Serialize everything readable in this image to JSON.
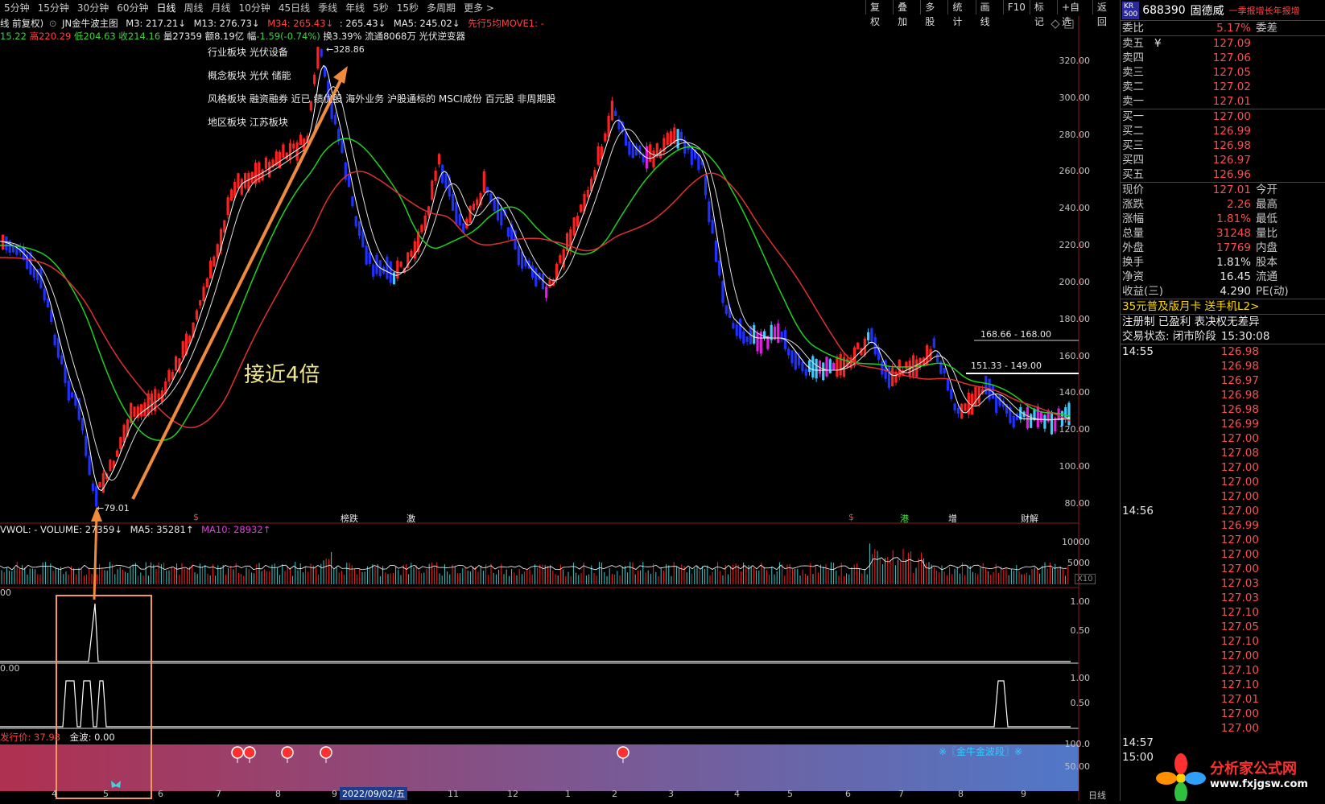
{
  "top_tabs": [
    "5分钟",
    "15分钟",
    "30分钟",
    "60分钟",
    "日线",
    "周线",
    "月线",
    "10分钟",
    "45日线",
    "季线",
    "年线",
    "5秒",
    "15秒",
    "多周期",
    "更多 >"
  ],
  "active_tab": "日线",
  "toolbar": [
    "复权",
    "叠加",
    "多股",
    "统计",
    "画线",
    "F10",
    "标记",
    "+自选",
    "返回"
  ],
  "chart_header": {
    "adjust": "线 前复权)",
    "indicator_name": "JN金牛波主图",
    "ma3": "M3: 217.21↓",
    "m13": "M13: 276.73↓",
    "m34": "M34: 265.43↓",
    "m34b": ": 265.43↓",
    "ma5": "MA5: 245.02↓",
    "move": "先行5均MOVE1: -"
  },
  "ohlc_line": {
    "open": "15.22",
    "high_label": "高",
    "high": "220.29",
    "low_label": "低",
    "low": "204.63",
    "close_label": "收",
    "close": "214.16",
    "vol_label": "量",
    "vol": "27359",
    "amt_label": "额",
    "amt": "8.19亿",
    "chg_label": "幅",
    "chg": "-1.59(-0.74%)",
    "turnover": "换3.39%",
    "float": "流通8068万",
    "sector": "光伏逆变器"
  },
  "sector_info": [
    "行业板块 光伏设备",
    "概念板块 光伏 储能",
    "风格板块 融资融券 近已 绩优股 海外业务 沪股通标的 MSCI成份 百元股 非周期股",
    "地区板块 江苏板块"
  ],
  "annotations": {
    "big": "接近4倍",
    "high_price": "328.86",
    "low_price": "79.01",
    "range1": "168.66 - 168.00",
    "range2": "151.33 - 149.00"
  },
  "event_markers": [
    "$",
    "榜跌",
    "激",
    "$",
    "港",
    "增",
    "财解"
  ],
  "volume_line": "VWOL: - VOLUME: 27359↓ MA5: 35281↑ MA10: 28932↑",
  "volume_parts": {
    "a": "VWOL: - VOLUME: 27359↓",
    "b": "MA5: 35281↑",
    "c": "MA10: 28932↑"
  },
  "ind_a_label": "00",
  "ind_b_label": "0.00",
  "ind2_line": {
    "a": "发行价: 37.98",
    "b": "金波: 0.00"
  },
  "gold_label": "※〖金牛金波段〗※",
  "x10": "X10",
  "date_box": "2022/09/02/五",
  "y_ticks_main": [
    "320.00",
    "300.00",
    "280.00",
    "260.00",
    "240.00",
    "220.00",
    "200.00",
    "180.00",
    "160.00",
    "140.00",
    "120.00",
    "100.00",
    "80.00"
  ],
  "y_ticks_vol": [
    "10000",
    "5000"
  ],
  "y_ticks_ind_a": [
    "1.00",
    "0.50"
  ],
  "y_ticks_ind_b": [
    "1.00",
    "0.50"
  ],
  "y_ticks_ind_c": [
    "100.0",
    "50.00"
  ],
  "x_ticks": [
    "4",
    "5",
    "6",
    "7",
    "8",
    "9",
    "10",
    "11",
    "12",
    "1",
    "2",
    "3",
    "4",
    "5",
    "6",
    "7",
    "8",
    "9"
  ],
  "period_label": "日线",
  "right_panel": {
    "kr": "KR",
    "kr_sub": "500",
    "code": "688390",
    "name": "固德威",
    "ad": "一季报增长年报增",
    "weibi_label": "委比",
    "weibi_val": "5.17%",
    "weicha_label": "委差",
    "sell": [
      {
        "label": "卖五",
        "price": "127.09"
      },
      {
        "label": "卖四",
        "price": "127.06"
      },
      {
        "label": "卖三",
        "price": "127.05"
      },
      {
        "label": "卖二",
        "price": "127.02"
      },
      {
        "label": "卖一",
        "price": "127.01"
      }
    ],
    "sell_five_mark": "¥",
    "buy": [
      {
        "label": "买一",
        "price": "127.00"
      },
      {
        "label": "买二",
        "price": "126.99"
      },
      {
        "label": "买三",
        "price": "126.98"
      },
      {
        "label": "买四",
        "price": "126.97"
      },
      {
        "label": "买五",
        "price": "126.96"
      }
    ],
    "stats": [
      {
        "l1": "现价",
        "v1": "127.01",
        "l2": "今开",
        "v2": ""
      },
      {
        "l1": "涨跌",
        "v1": "2.26",
        "l2": "最高",
        "v2": ""
      },
      {
        "l1": "涨幅",
        "v1": "1.81%",
        "l2": "最低",
        "v2": ""
      },
      {
        "l1": "总量",
        "v1": "31248",
        "l2": "量比",
        "v2": ""
      },
      {
        "l1": "外盘",
        "v1": "17769",
        "l2": "内盘",
        "v2": ""
      },
      {
        "l1": "换手",
        "v1": "1.81%",
        "l2": "股本",
        "v2": ""
      },
      {
        "l1": "净资",
        "v1": "16.45",
        "l2": "流通",
        "v2": ""
      },
      {
        "l1": "收益(三)",
        "v1": "4.290",
        "l2": "PE(动)",
        "v2": ""
      }
    ],
    "promo1": "35元普及版月卡 送手机L2>",
    "promo2": "注册制 已盈利 表决权无差异",
    "status_label": "交易状态: 闭市阶段",
    "status_time": "15:30:08",
    "ticks": [
      {
        "t": "14:55",
        "p": "126.98"
      },
      {
        "t": "",
        "p": "126.98"
      },
      {
        "t": "",
        "p": "126.97"
      },
      {
        "t": "",
        "p": "126.98"
      },
      {
        "t": "",
        "p": "126.98"
      },
      {
        "t": "",
        "p": "126.99"
      },
      {
        "t": "",
        "p": "127.00"
      },
      {
        "t": "",
        "p": "127.08"
      },
      {
        "t": "",
        "p": "127.00"
      },
      {
        "t": "",
        "p": "127.00"
      },
      {
        "t": "",
        "p": "127.00"
      },
      {
        "t": "14:56",
        "p": "127.00"
      },
      {
        "t": "",
        "p": "126.99"
      },
      {
        "t": "",
        "p": "127.00"
      },
      {
        "t": "",
        "p": "127.00"
      },
      {
        "t": "",
        "p": "127.00"
      },
      {
        "t": "",
        "p": "127.03"
      },
      {
        "t": "",
        "p": "127.03"
      },
      {
        "t": "",
        "p": "127.10"
      },
      {
        "t": "",
        "p": "127.05"
      },
      {
        "t": "",
        "p": "127.10"
      },
      {
        "t": "",
        "p": "127.00"
      },
      {
        "t": "",
        "p": "127.10"
      },
      {
        "t": "",
        "p": "127.10"
      },
      {
        "t": "",
        "p": "127.01"
      },
      {
        "t": "",
        "p": "127.00"
      },
      {
        "t": "",
        "p": "127.00"
      },
      {
        "t": "14:57",
        "p": ""
      },
      {
        "t": "15:00",
        "p": ""
      }
    ],
    "logo_text": "分析家公式网",
    "logo_url": "www.fxjgsw.com"
  },
  "colors": {
    "up": "#ff2020",
    "down": "#2030ff",
    "cyan": "#40c8ff",
    "magenta": "#e020e0",
    "ma_green": "#20d020",
    "ma_red": "#e03030",
    "annot_orange": "#f08a3c"
  }
}
